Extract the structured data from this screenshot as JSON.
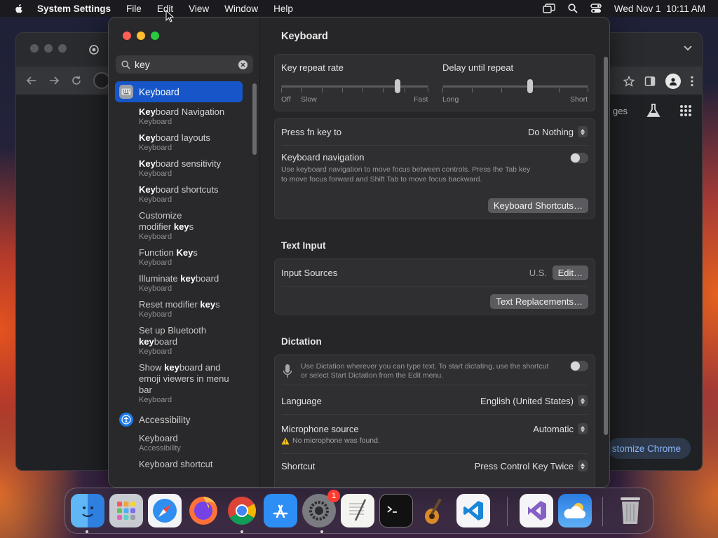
{
  "menubar": {
    "app_name": "System Settings",
    "items": [
      "File",
      "Edit",
      "View",
      "Window",
      "Help"
    ],
    "clock": "Wed Nov 1  10:11 AM"
  },
  "chrome_window": {
    "page_partial_text": "ges",
    "customize_label": "stomize Chrome"
  },
  "settings": {
    "search": {
      "query": "key"
    },
    "sidebar": {
      "main_result": "Keyboard",
      "results": [
        {
          "highlight": "Key",
          "rest": "board Navigation",
          "category": "Keyboard"
        },
        {
          "highlight": "Key",
          "rest": "board layouts",
          "category": "Keyboard"
        },
        {
          "highlight": "Key",
          "rest": "board sensitivity",
          "category": "Keyboard"
        },
        {
          "highlight": "Key",
          "rest": "board shortcuts",
          "category": "Keyboard"
        }
      ],
      "modifier_pre": "Customize",
      "modifier_line2_pre": "modifier ",
      "modifier_line2_hl": "key",
      "modifier_line2_post": "s",
      "modifier_cat": "Keyboard",
      "function_pre": "Function ",
      "function_hl": "Key",
      "function_post": "s",
      "function_cat": "Keyboard",
      "illum_pre": "Illuminate ",
      "illum_hl": "key",
      "illum_post": "board",
      "illum_cat": "Keyboard",
      "reset_pre": "Reset modifier ",
      "reset_hl": "key",
      "reset_post": "s",
      "reset_cat": "Keyboard",
      "bt_line1": "Set up Bluetooth",
      "bt_hl": "key",
      "bt_post": "board",
      "bt_cat": "Keyboard",
      "emoji_pre": "Show ",
      "emoji_hl": "key",
      "emoji_post": "board and",
      "emoji_line2": "emoji viewers in menu",
      "emoji_line3": "bar",
      "emoji_cat": "Keyboard",
      "accessibility_section": "Accessibility",
      "acc_result1": "Keyboard",
      "acc_result1_cat": "Accessibility",
      "acc_result2": "Keyboard shortcut"
    },
    "content": {
      "title": "Keyboard",
      "repeat_rate": {
        "label": "Key repeat rate",
        "min_labels": [
          "Off",
          "Slow"
        ],
        "max_label": "Fast",
        "value_fraction": 0.79
      },
      "delay": {
        "label": "Delay until repeat",
        "min_label": "Long",
        "max_label": "Short",
        "value_fraction": 0.6
      },
      "fn_key": {
        "label": "Press fn key to",
        "value": "Do Nothing"
      },
      "keyboard_nav": {
        "label": "Keyboard navigation",
        "desc_line1": "Use keyboard navigation to move focus between controls. Press the Tab key",
        "desc_line2": "to move focus forward and Shift Tab to move focus backward.",
        "enabled": false
      },
      "shortcuts_button": "Keyboard Shortcuts…",
      "text_input_heading": "Text Input",
      "input_sources": {
        "label": "Input Sources",
        "value": "U.S.",
        "edit_button": "Edit…"
      },
      "text_replacements_button": "Text Replacements…",
      "dictation_heading": "Dictation",
      "dictation": {
        "desc_line1": "Use Dictation wherever you can type text. To start dictating, use the shortcut",
        "desc_line2": "or select Start Dictation from the Edit menu.",
        "enabled": false
      },
      "language": {
        "label": "Language",
        "value": "English (United States)"
      },
      "microphone": {
        "label": "Microphone source",
        "value": "Automatic",
        "warning": "No microphone was found."
      },
      "shortcut": {
        "label": "Shortcut",
        "value": "Press Control Key Twice"
      }
    }
  },
  "dock": {
    "apps": [
      "Finder",
      "Launchpad",
      "Safari",
      "Firefox",
      "Google Chrome",
      "App Store",
      "System Settings",
      "TextEdit",
      "Terminal",
      "GarageBand",
      "Visual Studio Code",
      "Visual Studio",
      "Weather",
      "Trash"
    ],
    "badge_count": "1"
  },
  "colors": {
    "accent": "#1756c8",
    "close": "#ff5f57",
    "minimize": "#febc2e",
    "zoom": "#28c840",
    "warning": "#f5c518"
  }
}
